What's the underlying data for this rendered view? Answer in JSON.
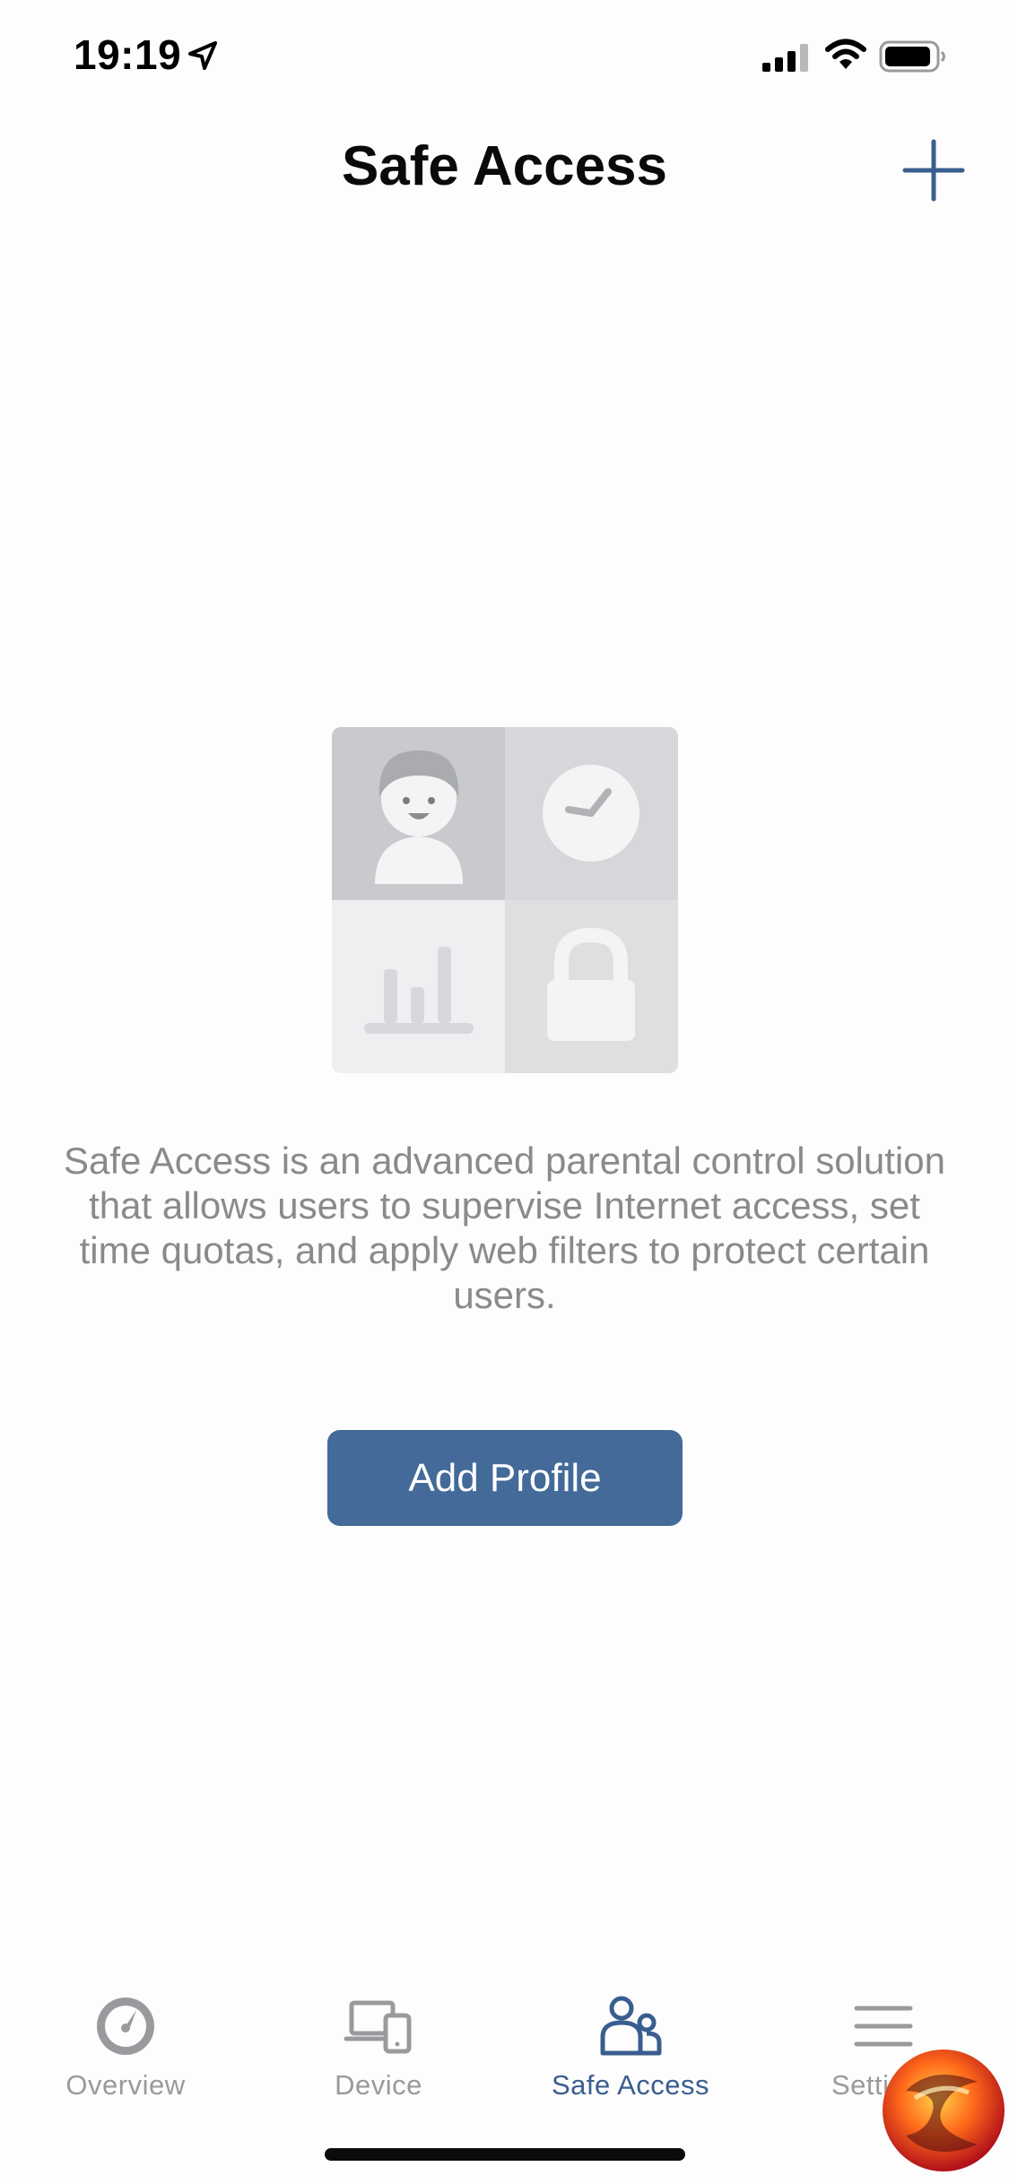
{
  "status_bar": {
    "time": "19:19"
  },
  "header": {
    "title": "Safe Access"
  },
  "main": {
    "description": "Safe Access is an advanced parental control solution that allows users to supervise Internet access, set time quotas, and apply web filters to protect certain users.",
    "add_profile_label": "Add Profile"
  },
  "tab_bar": {
    "tabs": [
      {
        "label": "Overview",
        "icon": "gauge-icon",
        "active": false
      },
      {
        "label": "Device",
        "icon": "devices-icon",
        "active": false
      },
      {
        "label": "Safe Access",
        "icon": "people-icon",
        "active": true
      },
      {
        "label": "Settings",
        "icon": "menu-icon",
        "active": false
      }
    ]
  },
  "colors": {
    "accent": "#436a98",
    "tab_active": "#3a5d8f",
    "tab_inactive": "#9a9a9e",
    "description_text": "#8a8a8e"
  }
}
